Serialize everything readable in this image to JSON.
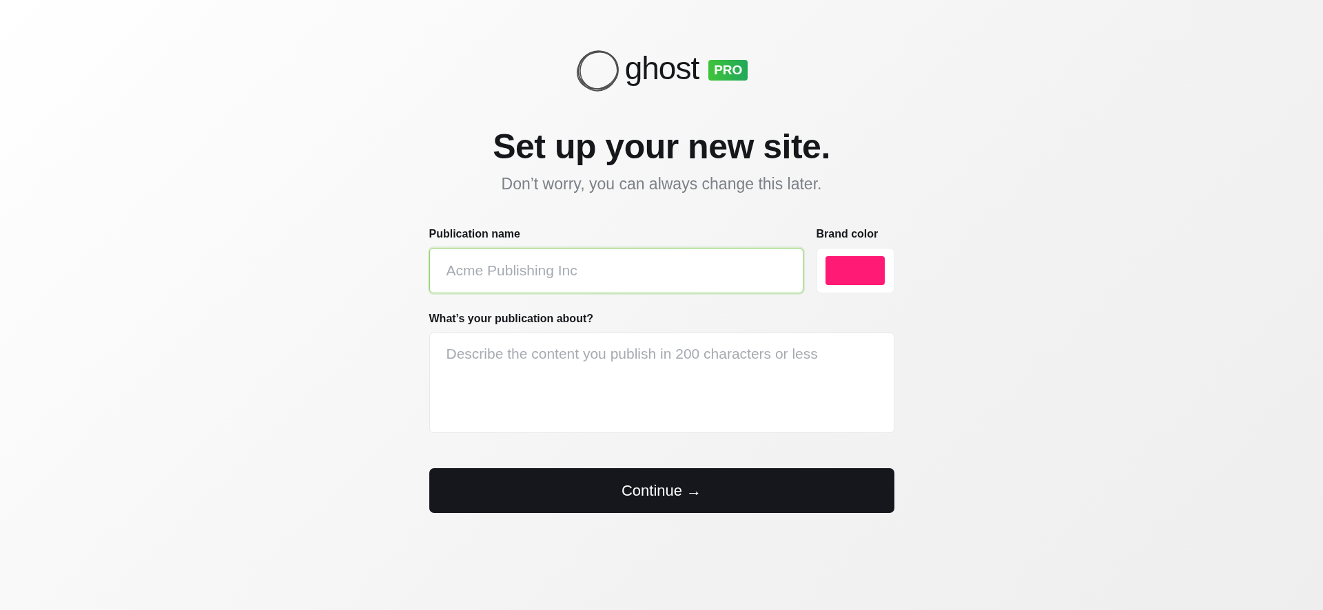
{
  "logo": {
    "wordmark": "ghost",
    "badge": "PRO"
  },
  "heading": "Set up your new site.",
  "subheading": "Don’t worry, you can always change this later.",
  "publication_name": {
    "label": "Publication name",
    "placeholder": "Acme Publishing Inc",
    "focused": true
  },
  "brand_color": {
    "label": "Brand color",
    "color": "#ff1a75"
  },
  "about": {
    "label": "What’s your publication about?",
    "placeholder": "Describe the content you publish in 200 characters or less"
  },
  "continue_button": "Continue →"
}
